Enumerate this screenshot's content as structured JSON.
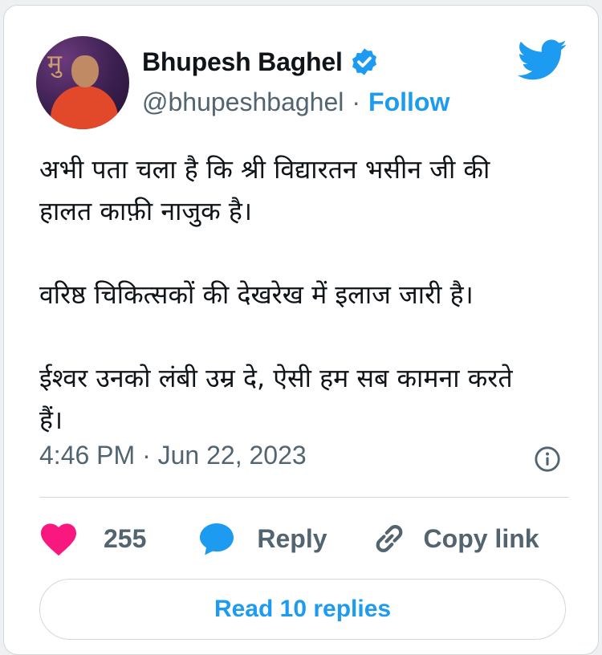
{
  "author": {
    "name": "Bhupesh Baghel",
    "handle": "@bhupeshbaghel",
    "separator": "·",
    "follow_label": "Follow",
    "avatar_lettering": "मु"
  },
  "tweet": {
    "text": "अभी पता चला है कि श्री विद्यारतन भसीन जी की\nहालत काफ़ी नाजुक है।\n\nवरिष्ठ चिकित्सकों की देखरेख में इलाज जारी है।\n\nईश्वर उनको लंबी उम्र दे, ऐसी हम सब कामना करते\nहैं।",
    "timestamp": "4:46 PM · Jun 22, 2023"
  },
  "actions": {
    "likes_count": "255",
    "reply_label": "Reply",
    "copy_link_label": "Copy link"
  },
  "read_replies_label": "Read 10 replies",
  "colors": {
    "accent": "#1d9bf0",
    "like": "#f91880",
    "secondary_text": "#536471",
    "border": "#cfd9de"
  },
  "icons": [
    "verified-badge-icon",
    "twitter-bird-icon",
    "info-icon",
    "heart-icon",
    "reply-bubble-icon",
    "link-icon"
  ]
}
